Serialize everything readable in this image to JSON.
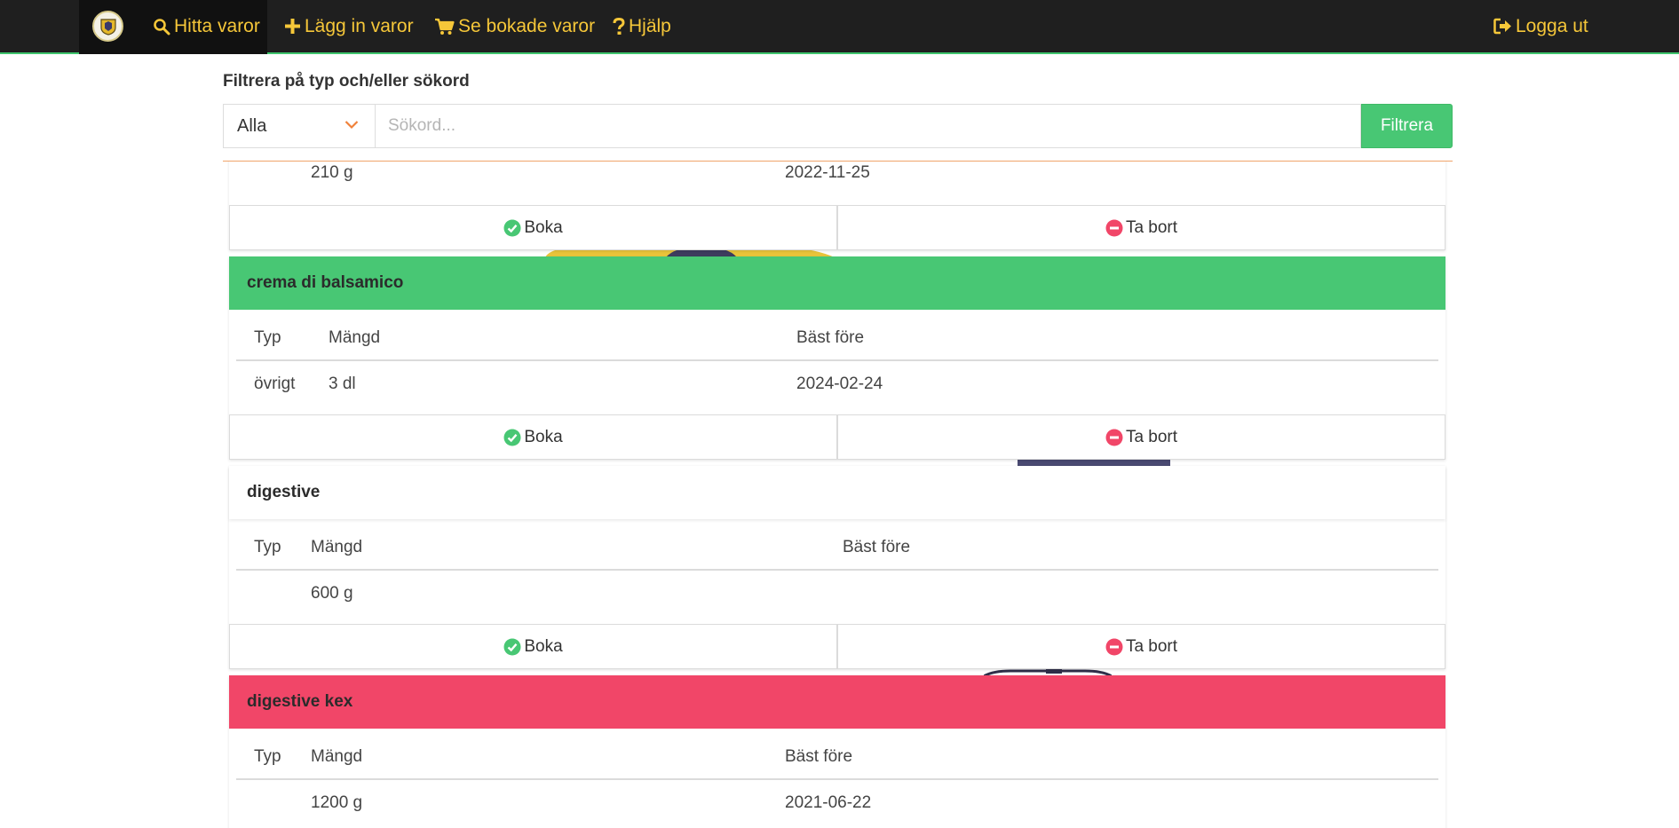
{
  "nav": {
    "find": "Hitta varor",
    "add": "Lägg in varor",
    "booked": "Se bokade varor",
    "help": "Hjälp",
    "logout": "Logga ut"
  },
  "filter": {
    "title": "Filtrera på typ och/eller sökord",
    "select_value": "Alla",
    "search_placeholder": "Sökord...",
    "button": "Filtrera"
  },
  "actions": {
    "book": "Boka",
    "remove": "Ta bort"
  },
  "columns": {
    "type": "Typ",
    "amount": "Mängd",
    "best_before": "Bäst före"
  },
  "items": [
    {
      "name": "",
      "type": "",
      "amount": "210 g",
      "best_before": "2022-11-25",
      "header": "none"
    },
    {
      "name": "crema di balsamico",
      "type": "övrigt",
      "amount": "3 dl",
      "best_before": "2024-02-24",
      "header": "green"
    },
    {
      "name": "digestive",
      "type": "",
      "amount": "600 g",
      "best_before": "",
      "header": "white"
    },
    {
      "name": "digestive kex",
      "type": "",
      "amount": "1200 g",
      "best_before": "2021-06-22",
      "header": "red"
    }
  ],
  "colors": {
    "navbar": "#1f1f1f",
    "nav_text": "#f6c739",
    "green": "#48c774",
    "red": "#f14668",
    "book_icon": "#48c774",
    "remove_icon": "#f14668"
  }
}
